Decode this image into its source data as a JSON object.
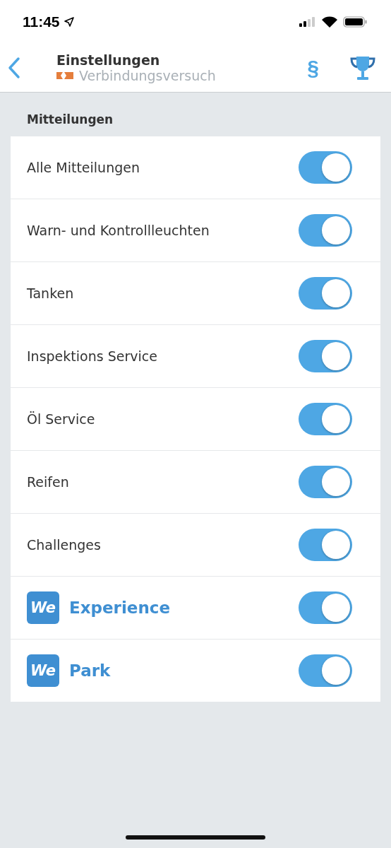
{
  "status_bar": {
    "time": "11:45"
  },
  "nav": {
    "title": "Einstellungen",
    "subtitle": "Verbindungsversuch",
    "section_sign": "§"
  },
  "section": {
    "title": "Mitteilungen"
  },
  "rows": [
    {
      "kind": "plain",
      "label": "Alle Mitteilungen",
      "on": true
    },
    {
      "kind": "plain",
      "label": "Warn- und Kontrollleuchten",
      "on": true
    },
    {
      "kind": "plain",
      "label": "Tanken",
      "on": true
    },
    {
      "kind": "plain",
      "label": "Inspektions Service",
      "on": true
    },
    {
      "kind": "plain",
      "label": "Öl Service",
      "on": true
    },
    {
      "kind": "plain",
      "label": "Reifen",
      "on": true
    },
    {
      "kind": "plain",
      "label": "Challenges",
      "on": true
    },
    {
      "kind": "brand",
      "logo": "We",
      "label": "Experience",
      "on": true
    },
    {
      "kind": "brand",
      "logo": "We",
      "label": "Park",
      "on": true
    }
  ]
}
